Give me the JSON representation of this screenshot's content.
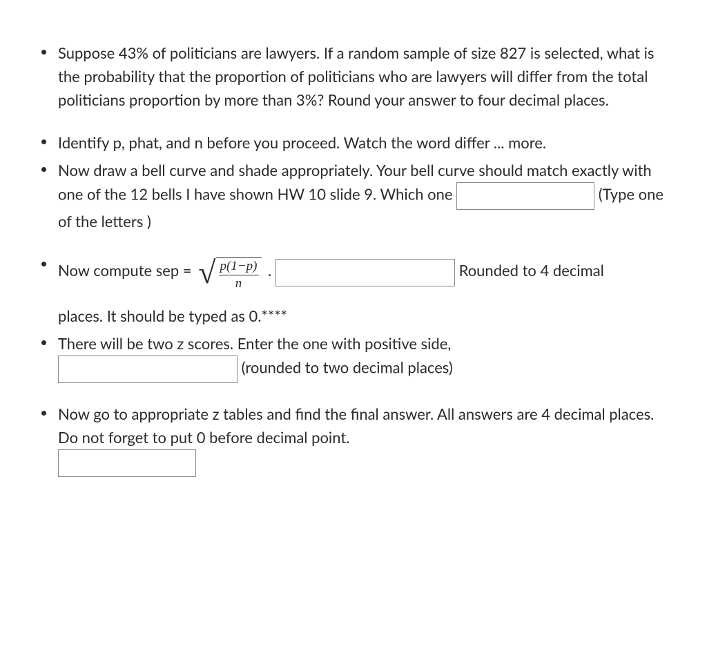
{
  "bullets": {
    "b1": "Suppose 43% of politicians are lawyers. If a random sample of size 827 is selected, what is the probability that the proportion of politicians who are lawyers will differ from the total politicians proportion by more than 3%? Round your answer to four decimal places.",
    "b2": "Identify p, phat, and n before you proceed. Watch the word differ ... more.",
    "b3_a": "Now draw a bell curve and shade appropriately. Your bell curve should match exactly with one of the 12 bells I have shown HW 10 slide 9. Which one ",
    "b3_b": " (Type one of the letters )",
    "b4_a": "Now compute sep = ",
    "b4_frac_top": "p(1−p)",
    "b4_frac_bot": "n",
    "b4_b": ". ",
    "b4_c": " Rounded to 4 decimal",
    "b4_cont": "places. It should be typed as 0.****",
    "b5_a": "There will be two  z scores. Enter the one with positive side, ",
    "b5_b": " (rounded to two decimal places)",
    "b6_a": "Now go to appropriate z tables and find the final answer. All answers are 4 decimal places. Do not forget to put 0 before decimal point."
  }
}
